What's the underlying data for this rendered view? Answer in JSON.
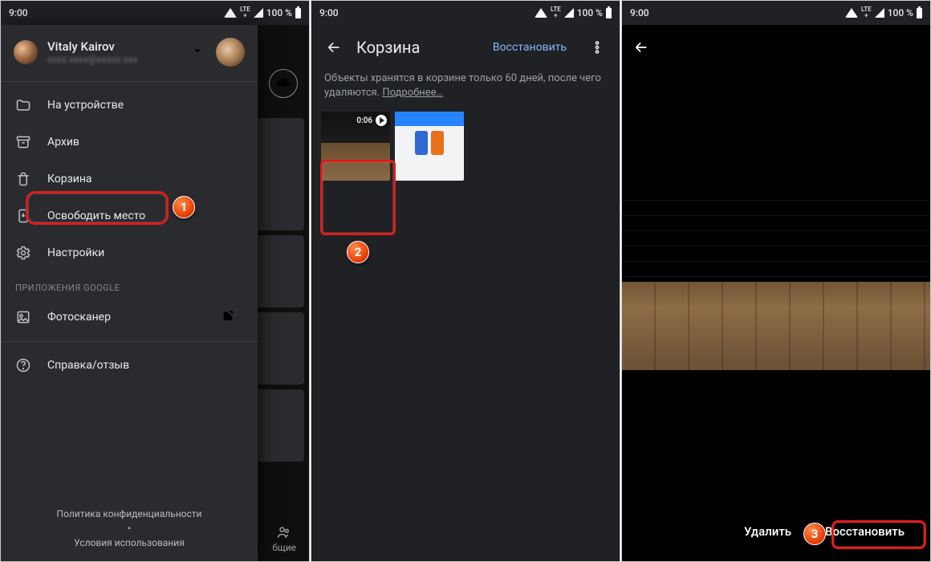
{
  "status": {
    "time": "9:00",
    "net_label": "LTE",
    "net_sub": "+",
    "battery": "100 %"
  },
  "screen1": {
    "user_name": "Vitaly Kairov",
    "user_email_masked": "xxxx.xxxx@xxxxx.xxx",
    "items": {
      "device": "На устройстве",
      "archive": "Архив",
      "trash": "Корзина",
      "free_space": "Освободить место",
      "settings": "Настройки"
    },
    "apps_section": "ПРИЛОЖЕНИЯ GOOGLE",
    "photoscan": "Фотосканер",
    "help": "Справка/отзыв",
    "privacy": "Политика конфиденциальности",
    "tos": "Условия использования",
    "bg_tab": "бщие"
  },
  "screen2": {
    "title": "Корзина",
    "restore": "Восстановить",
    "notice_a": "Объекты хранятся в корзине только 60 дней, после чего удаляются.  ",
    "notice_link": "Подробнее…",
    "video_duration": "0:06"
  },
  "screen3": {
    "delete": "Удалить",
    "restore": "Восстановить"
  },
  "badges": {
    "n1": "1",
    "n2": "2",
    "n3": "3"
  }
}
